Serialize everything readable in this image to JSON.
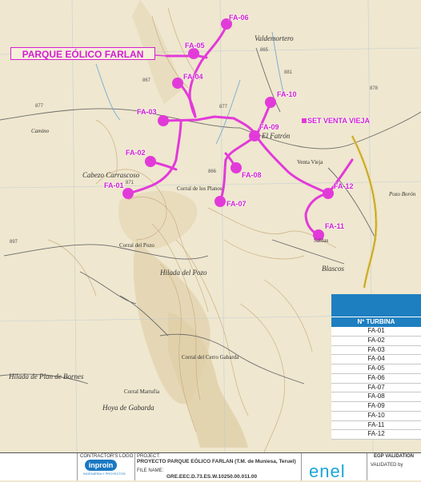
{
  "map": {
    "title": "PARQUE EÓLICO FARLAN",
    "substation_label": "SET VENTA VIEJA",
    "turbines": [
      "FA-01",
      "FA-02",
      "FA-03",
      "FA-04",
      "FA-05",
      "FA-06",
      "FA-07",
      "FA-08",
      "FA-09",
      "FA-10",
      "FA-11",
      "FA-12"
    ],
    "places": {
      "valdemortero": "Valdemortero",
      "el_fatron": "El Fatrón",
      "venta_vieja": "Venta Vieja",
      "pozo_boron": "Pozo Borón",
      "cabezo_carrascoso": "Cabezo Carrascoso",
      "corral_llanos": "Corral de los Planos",
      "corral_pozo": "Corral del Pozo",
      "hilada_pozo": "Hilada del Pozo",
      "blascos": "Blascos",
      "hilada_plan_bornes": "Hilada de Plan de Bornes",
      "corral_cerro_gabarda": "Corral del Cerro Gabarda",
      "hoya_gabarda": "Hoya de Gabarda",
      "corral_martufia": "Corral Martufia",
      "camino": "Camino",
      "saldas": "Saldas"
    },
    "elevations": [
      "865",
      "877",
      "871",
      "877",
      "881",
      "878",
      "867",
      "866",
      "897"
    ]
  },
  "table": {
    "header": "Nº TURBINA",
    "rows": [
      "FA-01",
      "FA-02",
      "FA-03",
      "FA-04",
      "FA-05",
      "FA-06",
      "FA-07",
      "FA-08",
      "FA-09",
      "FA-10",
      "FA-11",
      "FA-12"
    ]
  },
  "titleblock": {
    "contractor_logo_label": "CONTRACTOR'S LOGO",
    "contractor_logo": "inproin",
    "contractor_logo_sub": "INGENIERIA Y PROYECTOS",
    "project_label": "PROJECT:",
    "project_value": "PROYECTO PARQUE EÓLICO FARLAN (T.M. de Muniesa, Teruel)",
    "file_label": "FILE NAME:",
    "file_value": "GRE.EEC.D.73.ES.W.10250.00.011.00",
    "brand": "enel",
    "validation_label": "EGP VALIDATION",
    "validated_by_label": "VALIDATED by"
  }
}
